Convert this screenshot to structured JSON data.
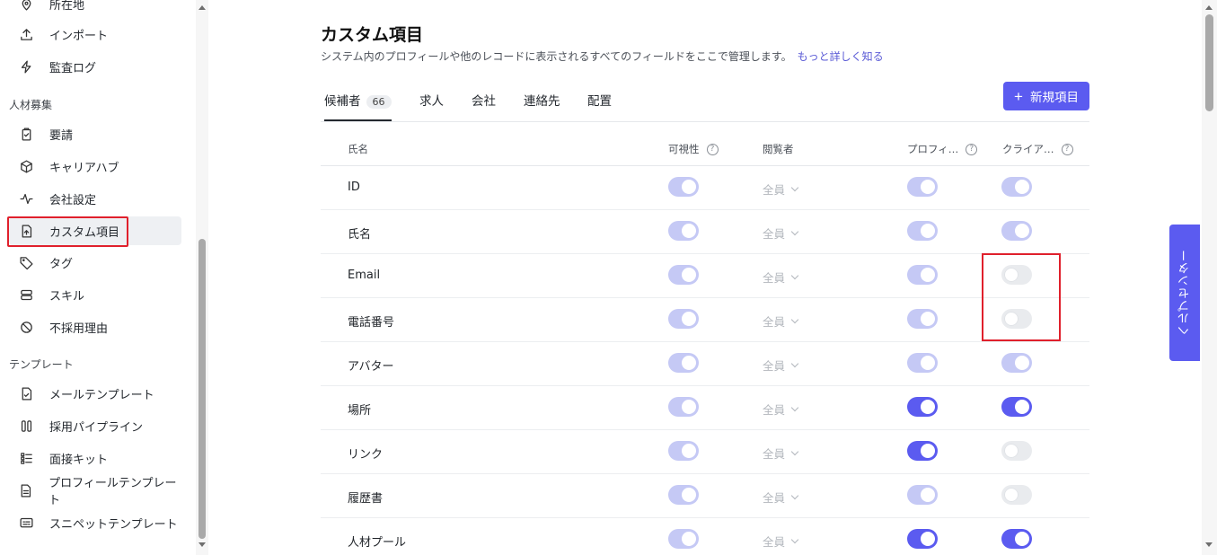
{
  "sidebar": {
    "items_top": [
      {
        "label": "所在地",
        "icon": "location-pin-icon"
      },
      {
        "label": "インポート",
        "icon": "upload-icon"
      },
      {
        "label": "監査ログ",
        "icon": "lightning-icon"
      }
    ],
    "section_recruit": "人材募集",
    "items_recruit": [
      {
        "label": "要請",
        "icon": "clipboard-check-icon"
      },
      {
        "label": "キャリアハブ",
        "icon": "cube-icon"
      },
      {
        "label": "会社設定",
        "icon": "pulse-icon"
      },
      {
        "label": "カスタム項目",
        "icon": "file-upload-icon",
        "active": true
      },
      {
        "label": "タグ",
        "icon": "tag-icon"
      },
      {
        "label": "スキル",
        "icon": "layers-icon"
      },
      {
        "label": "不採用理由",
        "icon": "ban-icon"
      }
    ],
    "section_template": "テンプレート",
    "items_template": [
      {
        "label": "メールテンプレート",
        "icon": "file-check-icon"
      },
      {
        "label": "採用パイプライン",
        "icon": "columns-icon"
      },
      {
        "label": "面接キット",
        "icon": "list-icon"
      },
      {
        "label": "プロフィールテンプレート",
        "icon": "document-icon"
      },
      {
        "label": "スニペットテンプレート",
        "icon": "message-icon"
      }
    ]
  },
  "header": {
    "title": "カスタム項目",
    "description": "システム内のプロフィールや他のレコードに表示されるすべてのフィールドをここで管理します。",
    "learn_more": "もっと詳しく知る"
  },
  "tabs": [
    {
      "label": "候補者",
      "count": "66",
      "active": true
    },
    {
      "label": "求人"
    },
    {
      "label": "会社"
    },
    {
      "label": "連絡先"
    },
    {
      "label": "配置"
    }
  ],
  "new_button": "新規項目",
  "table": {
    "columns": {
      "name": "氏名",
      "visibility": "可視性",
      "viewer": "閲覧者",
      "profile": "プロフィ…",
      "client": "クライア…"
    },
    "rows": [
      {
        "name": "ID",
        "visibility": true,
        "viewer": "全員",
        "profile": true,
        "client": true
      },
      {
        "name": "氏名",
        "visibility": true,
        "viewer": "全員",
        "profile": true,
        "client": true
      },
      {
        "name": "Email",
        "visibility": true,
        "viewer": "全員",
        "profile": true,
        "client": false
      },
      {
        "name": "電話番号",
        "visibility": true,
        "viewer": "全員",
        "profile": true,
        "client": false
      },
      {
        "name": "アバター",
        "visibility": true,
        "viewer": "全員",
        "profile": true,
        "client": true
      },
      {
        "name": "場所",
        "visibility": true,
        "viewer": "全員",
        "profile": "strong",
        "client": "strong"
      },
      {
        "name": "リンク",
        "visibility": true,
        "viewer": "全員",
        "profile": "strong",
        "client": false
      },
      {
        "name": "履歴書",
        "visibility": true,
        "viewer": "全員",
        "profile": true,
        "client": false
      },
      {
        "name": "人材プール",
        "visibility": true,
        "viewer": "全員",
        "profile": "strong",
        "client": "strong"
      }
    ]
  },
  "help_center": "ヘルプセンター",
  "colors": {
    "accent": "#5b5bf0",
    "accent_soft": "#c5c9f5",
    "highlight": "#e0202c"
  }
}
